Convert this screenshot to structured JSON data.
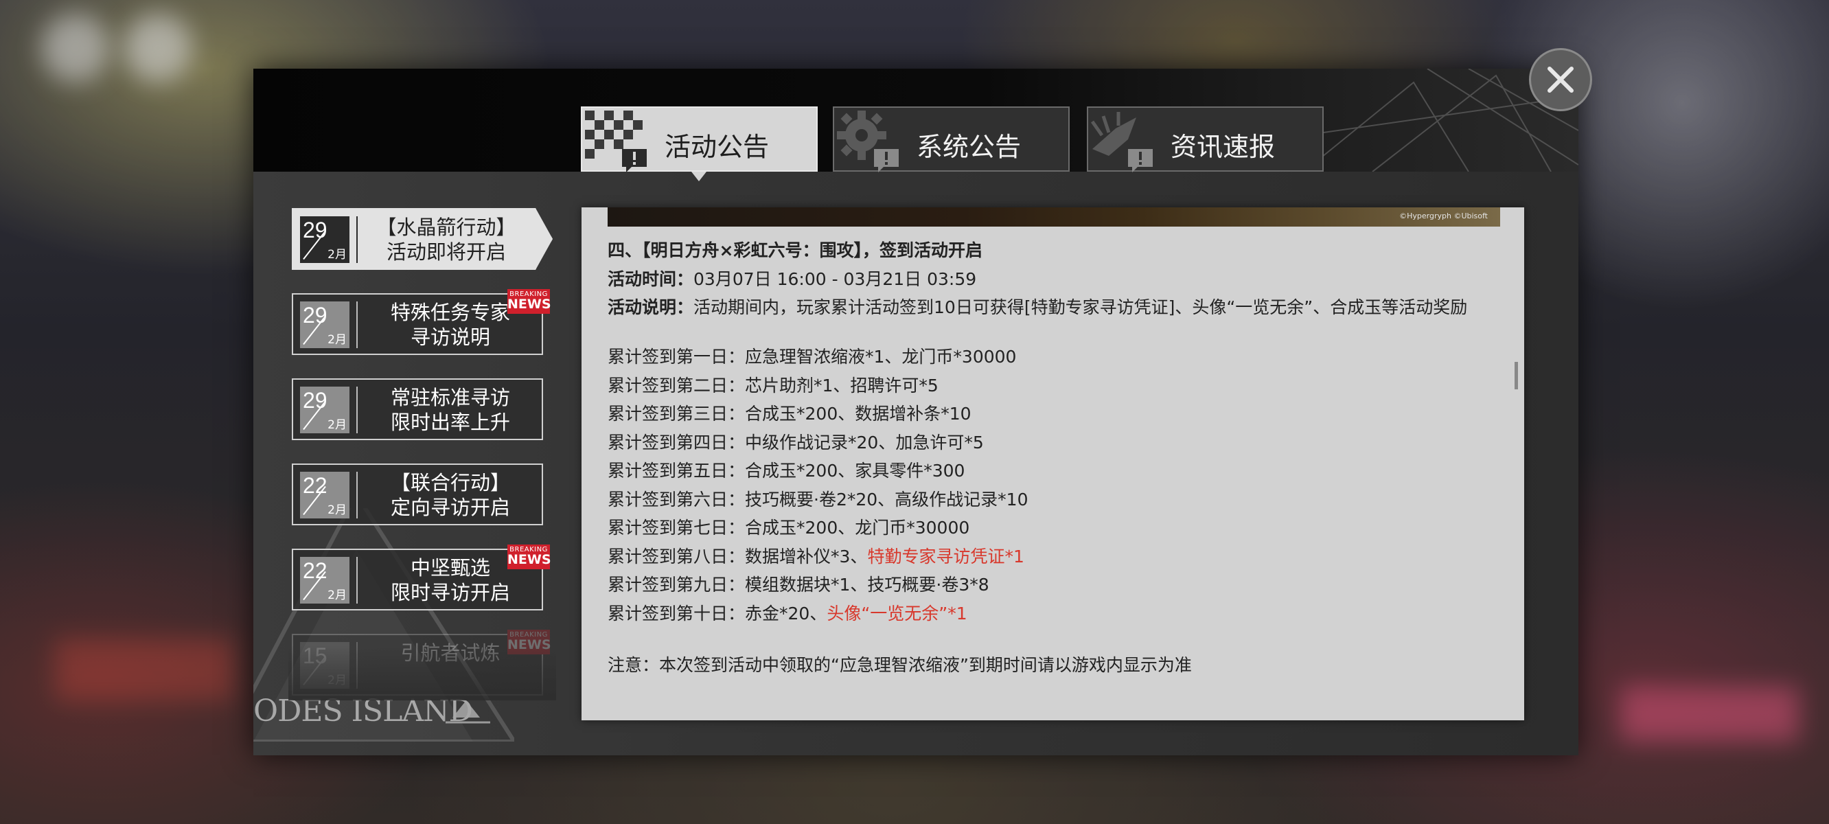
{
  "tabs": [
    {
      "label": "活动公告",
      "icon": "checkered-flag-alert-icon",
      "active": true
    },
    {
      "label": "系统公告",
      "icon": "gear-alert-icon",
      "active": false
    },
    {
      "label": "资讯速报",
      "icon": "megaphone-alert-icon",
      "active": false
    }
  ],
  "notices": [
    {
      "day": "29",
      "month": "2月",
      "title1": "【水晶箭行动】",
      "title2": "活动即将开启",
      "selected": true,
      "badge": false
    },
    {
      "day": "29",
      "month": "2月",
      "title1": "特殊任务专家",
      "title2": "寻访说明",
      "selected": false,
      "badge": true
    },
    {
      "day": "29",
      "month": "2月",
      "title1": "常驻标准寻访",
      "title2": "限时出率上升",
      "selected": false,
      "badge": false
    },
    {
      "day": "22",
      "month": "2月",
      "title1": "【联合行动】",
      "title2": "定向寻访开启",
      "selected": false,
      "badge": false
    },
    {
      "day": "22",
      "month": "2月",
      "title1": "中坚甄选",
      "title2": "限时寻访开启",
      "selected": false,
      "badge": true
    },
    {
      "day": "15",
      "month": "2月",
      "title1": "引航者试炼",
      "title2": "",
      "selected": false,
      "badge": true
    }
  ],
  "badge": {
    "top": "BREAKING",
    "bottom": "NEWS"
  },
  "logo_text": "ODES ISLAND",
  "content": {
    "banner_credit": "©Hypergryph ©Ubisoft",
    "heading": "四、【明日方舟×彩虹六号：围攻】，签到活动开启",
    "time_label": "活动时间：",
    "time_value": "03月07日 16:00 - 03月21日 03:59",
    "desc_label": "活动说明：",
    "desc_value": "活动期间内，玩家累计活动签到10日可获得[特勤专家寻访凭证]、头像“一览无余”、合成玉等活动奖励",
    "days": [
      {
        "prefix": "累计签到第一日：",
        "text": "应急理智浓缩液*1、龙门币*30000",
        "highlight": ""
      },
      {
        "prefix": "累计签到第二日：",
        "text": "芯片助剂*1、招聘许可*5",
        "highlight": ""
      },
      {
        "prefix": "累计签到第三日：",
        "text": "合成玉*200、数据增补条*10",
        "highlight": ""
      },
      {
        "prefix": "累计签到第四日：",
        "text": "中级作战记录*20、加急许可*5",
        "highlight": ""
      },
      {
        "prefix": "累计签到第五日：",
        "text": "合成玉*200、家具零件*300",
        "highlight": ""
      },
      {
        "prefix": "累计签到第六日：",
        "text": "技巧概要·卷2*20、高级作战记录*10",
        "highlight": ""
      },
      {
        "prefix": "累计签到第七日：",
        "text": "合成玉*200、龙门币*30000",
        "highlight": ""
      },
      {
        "prefix": "累计签到第八日：",
        "text": "数据增补仪*3、",
        "highlight": "特勤专家寻访凭证*1"
      },
      {
        "prefix": "累计签到第九日：",
        "text": "模组数据块*1、技巧概要·卷3*8",
        "highlight": ""
      },
      {
        "prefix": "累计签到第十日：",
        "text": "赤金*20、",
        "highlight": "头像“一览无余”*1"
      }
    ],
    "note": "注意：本次签到活动中领取的“应急理智浓缩液”到期时间请以游戏内显示为准"
  },
  "colors": {
    "highlight": "#d8382c",
    "badge": "#d0202c",
    "panel": "#d2d2d2"
  }
}
